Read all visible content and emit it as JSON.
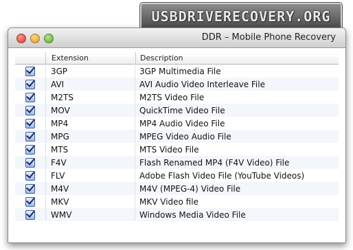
{
  "banner": {
    "text": "USBDRIVERECOVERY.ORG"
  },
  "window": {
    "title": "DDR – Mobile Phone Recovery"
  },
  "table": {
    "headers": {
      "extension": "Extension",
      "description": "Description"
    },
    "rows": [
      {
        "ext": "3GP",
        "desc": "3GP Multimedia File",
        "checked": true
      },
      {
        "ext": "AVI",
        "desc": "AVI Audio Video Interleave File",
        "checked": true
      },
      {
        "ext": "M2TS",
        "desc": "M2TS Video File",
        "checked": true
      },
      {
        "ext": "MOV",
        "desc": "QuickTime Video File",
        "checked": true
      },
      {
        "ext": "MP4",
        "desc": "MP4 Audio Video File",
        "checked": true
      },
      {
        "ext": "MPG",
        "desc": "MPEG Video Audio File",
        "checked": true
      },
      {
        "ext": "MTS",
        "desc": "MTS Video File",
        "checked": true
      },
      {
        "ext": "F4V",
        "desc": "Flash Renamed MP4 (F4V Video) File",
        "checked": true
      },
      {
        "ext": "FLV",
        "desc": "Adobe Flash Video File (YouTube Videos)",
        "checked": true
      },
      {
        "ext": "M4V",
        "desc": "M4V (MPEG-4) Video File",
        "checked": true
      },
      {
        "ext": "MKV",
        "desc": "MKV Video file",
        "checked": true
      },
      {
        "ext": "WMV",
        "desc": "Windows Media Video File",
        "checked": true
      }
    ]
  }
}
